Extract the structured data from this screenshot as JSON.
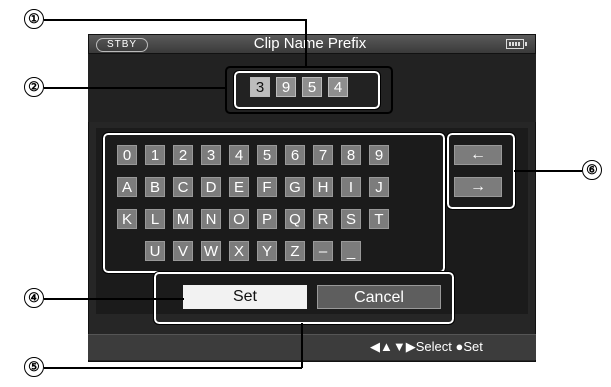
{
  "header": {
    "status_badge": "STBY",
    "title": "Clip Name Prefix"
  },
  "prefix": {
    "chars": [
      "3",
      "9",
      "5",
      "4"
    ]
  },
  "keyboard": {
    "row1": [
      "0",
      "1",
      "2",
      "3",
      "4",
      "5",
      "6",
      "7",
      "8",
      "9"
    ],
    "row2": [
      "A",
      "B",
      "C",
      "D",
      "E",
      "F",
      "G",
      "H",
      "I",
      "J"
    ],
    "row3": [
      "K",
      "L",
      "M",
      "N",
      "O",
      "P",
      "Q",
      "R",
      "S",
      "T"
    ],
    "row4": [
      "U",
      "V",
      "W",
      "X",
      "Y",
      "Z",
      "–",
      "_"
    ]
  },
  "arrows": {
    "left": "←",
    "right": "→"
  },
  "buttons": {
    "set": "Set",
    "cancel": "Cancel"
  },
  "footer": {
    "hint": "◀▲▼▶Select   ●Set"
  },
  "callouts": [
    "①",
    "②",
    "④",
    "⑤",
    "⑥"
  ],
  "icons": {
    "battery": "battery-icon"
  }
}
